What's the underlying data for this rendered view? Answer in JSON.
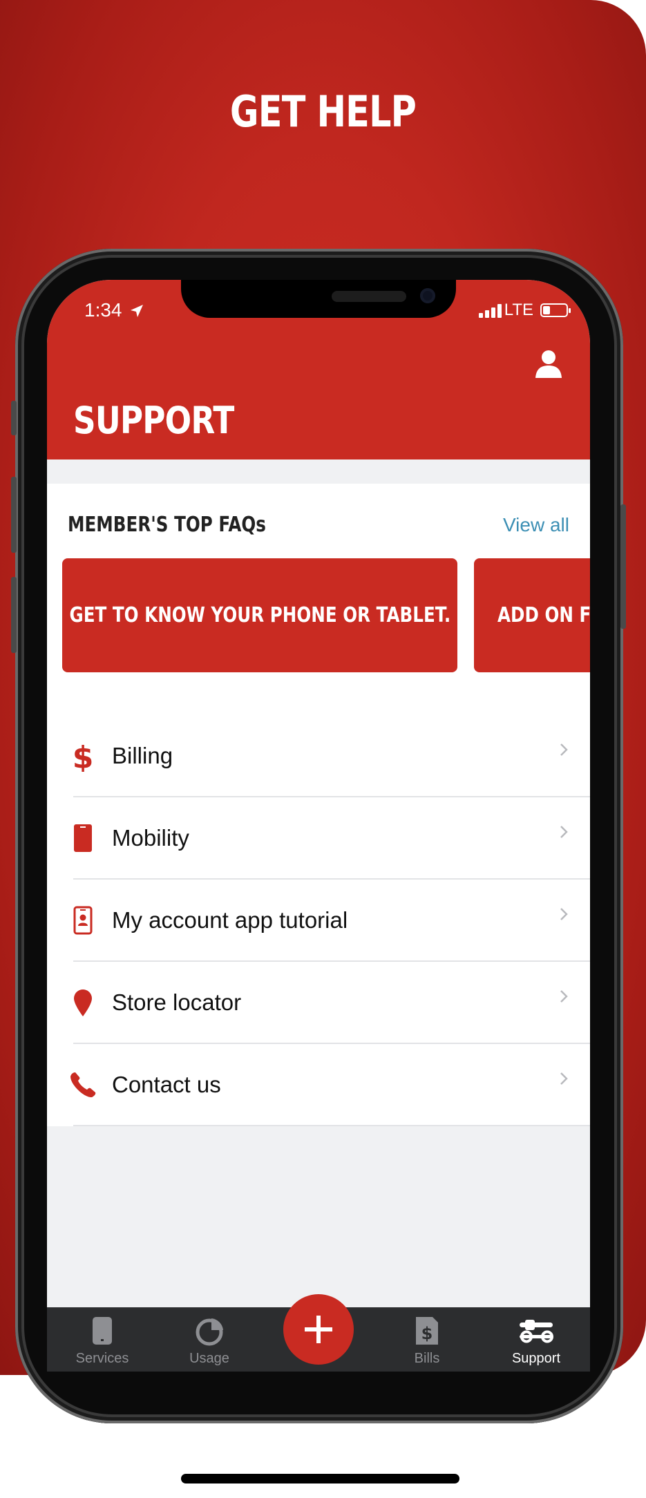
{
  "promo": {
    "title": "GET HELP"
  },
  "status_bar": {
    "time": "1:34",
    "network": "LTE"
  },
  "header": {
    "title": "SUPPORT"
  },
  "faqs": {
    "heading": "MEMBER'S TOP FAQs",
    "view_all": "View all",
    "cards": [
      "GET TO KNOW YOUR PHONE OR TABLET.",
      "ADD ON FEA"
    ]
  },
  "support_items": [
    {
      "label": "Billing",
      "icon": "dollar-icon"
    },
    {
      "label": "Mobility",
      "icon": "phone-icon"
    },
    {
      "label": "My account app tutorial",
      "icon": "phone-profile-icon"
    },
    {
      "label": "Store locator",
      "icon": "map-pin-icon"
    },
    {
      "label": "Contact us",
      "icon": "telephone-icon"
    }
  ],
  "tab_bar": {
    "tabs": [
      {
        "label": "Services",
        "icon": "device-icon"
      },
      {
        "label": "Usage",
        "icon": "pie-chart-icon"
      },
      {
        "label": "Bills",
        "icon": "bill-icon"
      },
      {
        "label": "Support",
        "icon": "wrench-icon"
      }
    ],
    "active": "Support",
    "fab_icon": "plus-icon"
  },
  "colors": {
    "brand_red": "#c92b22",
    "link_blue": "#3c8fb4",
    "tab_bar_bg": "#2c2d2f"
  }
}
